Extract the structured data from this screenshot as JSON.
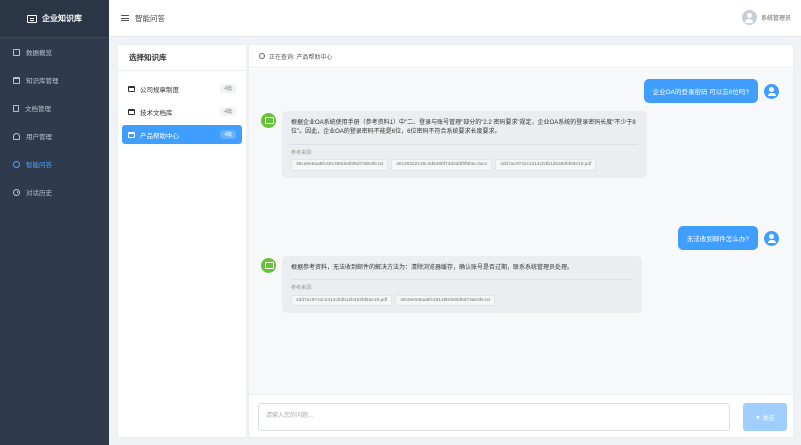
{
  "sidebar": {
    "brand": "企业知识库",
    "items": [
      {
        "label": "数据概览",
        "icon": "dashboard-icon"
      },
      {
        "label": "知识库管理",
        "icon": "folder-icon"
      },
      {
        "label": "文档管理",
        "icon": "document-icon"
      },
      {
        "label": "用户管理",
        "icon": "user-icon"
      },
      {
        "label": "智能问答",
        "icon": "chat-icon",
        "active": true
      },
      {
        "label": "对话历史",
        "icon": "history-icon"
      }
    ]
  },
  "header": {
    "title": "智能问答",
    "username": "系统管理员"
  },
  "kb_panel": {
    "title": "选择知识库",
    "items": [
      {
        "label": "公司规章制度",
        "count": "4篇"
      },
      {
        "label": "技术文档库",
        "count": "4篇"
      },
      {
        "label": "产品帮助中心",
        "count": "4篇",
        "active": true
      }
    ]
  },
  "chat": {
    "status": "正在查询: 产品帮助中心",
    "messages": [
      {
        "role": "user",
        "text": "企业OA的登录密码 可以忘6位吗?"
      },
      {
        "role": "bot",
        "text": "根据企业OA系统使用手册（参考资料1）中\"二、登录与账号管理\"部分的\"2.2 密码要求\"规定，企业OA系统的登录密码长度\"不少于8位\"。因此，企业OA的登录密码不能是6位，6位密码不符合系统要求长度要求。",
        "refs_label": "参考来源:",
        "refs": [
          "36ca9e5aa6fc461480de6bf8d73de3fe.txt",
          "a0c29322125c4d5480f73d3d3f9f9f3e.docx",
          "4dd7ac9742c2414cb3b12b492fd63e19.pdf"
        ]
      },
      {
        "role": "user",
        "text": "无法收到邮件怎么办?"
      },
      {
        "role": "bot",
        "text": "根据参考资料，无法收到邮件的解决方法为：清除浏览器缓存，确认账号是否过期，联系系统管理员处理。",
        "refs_label": "参考来源:",
        "refs": [
          "4dd7ac9742c2414cb3b12b492fd63e19.pdf",
          "36c5e0e5aa6fc461480de6bf8d73de3fe.txt"
        ]
      }
    ],
    "input_placeholder": "请输入您的问题...",
    "send_label": "发送"
  }
}
